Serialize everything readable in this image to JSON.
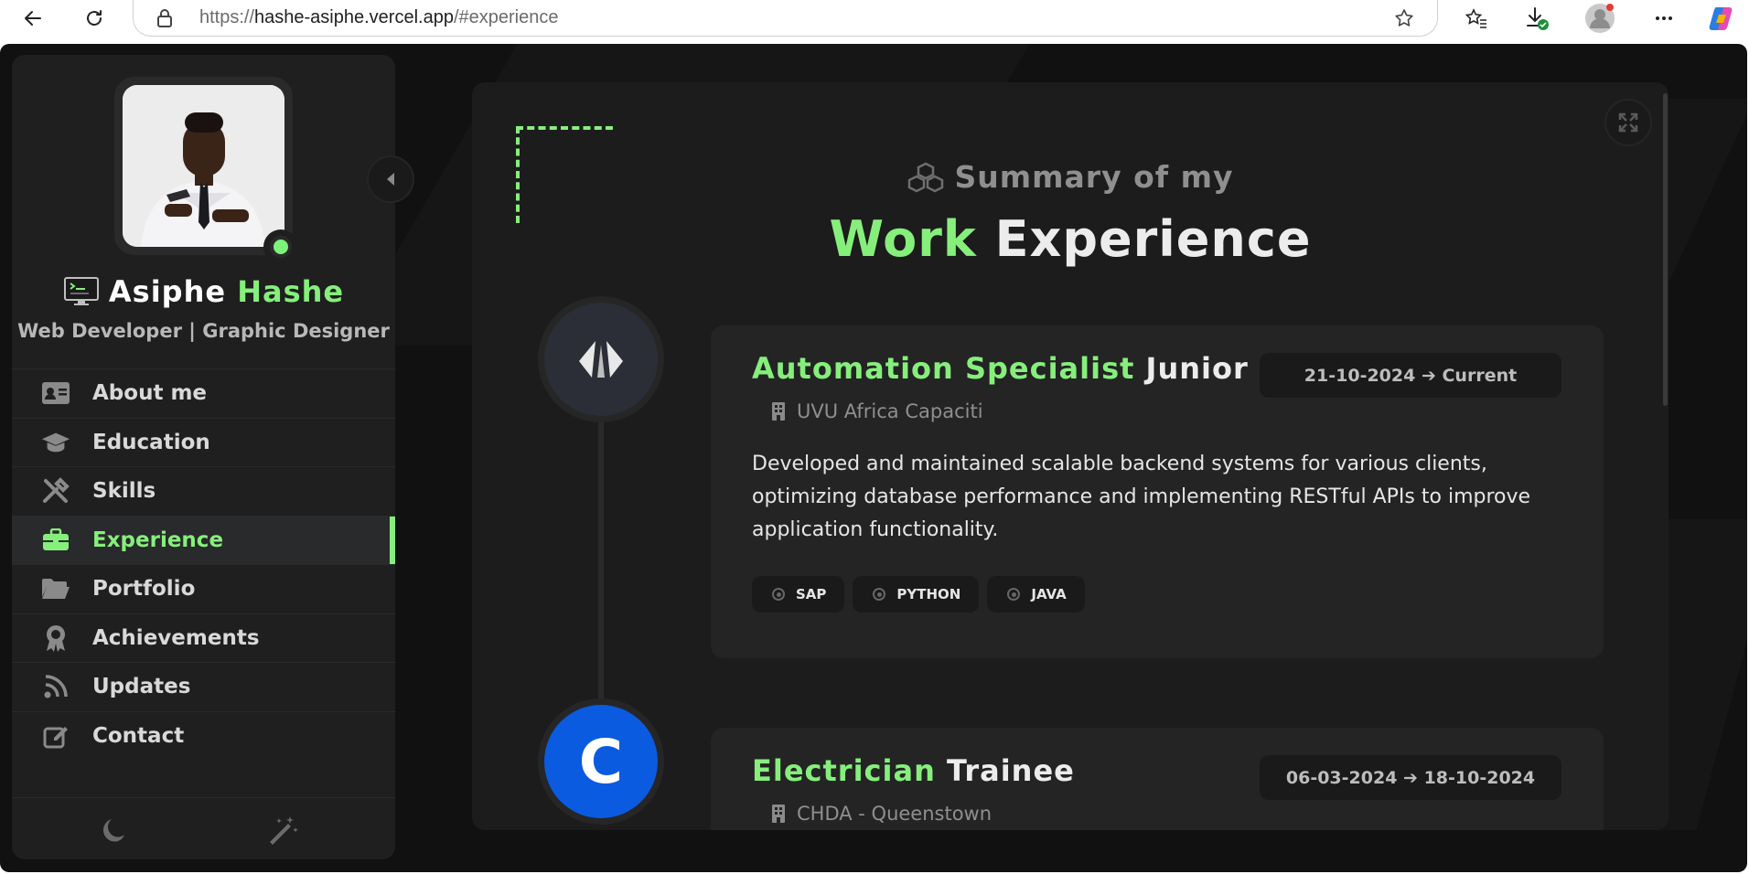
{
  "browser": {
    "url_prefix": "https://",
    "url_host": "hashe-asiphe.vercel.app",
    "url_path": "/#experience"
  },
  "profile": {
    "first_name": "Asiphe",
    "last_name": "Hashe",
    "role": "Web Developer | Graphic Designer",
    "status": "online"
  },
  "nav": {
    "items": [
      {
        "label": "About me",
        "icon": "id-card-icon"
      },
      {
        "label": "Education",
        "icon": "graduation-cap-icon"
      },
      {
        "label": "Skills",
        "icon": "tools-icon"
      },
      {
        "label": "Experience",
        "icon": "briefcase-icon",
        "active": true
      },
      {
        "label": "Portfolio",
        "icon": "folder-open-icon"
      },
      {
        "label": "Achievements",
        "icon": "award-icon"
      },
      {
        "label": "Updates",
        "icon": "rss-icon"
      },
      {
        "label": "Contact",
        "icon": "edit-icon"
      }
    ]
  },
  "section": {
    "subtitle": "Summary of my",
    "title_accent": "Work",
    "title_rest": "Experience"
  },
  "jobs": [
    {
      "title": "Automation Specialist",
      "level": "Junior",
      "dates": "21-10-2024 ➔ Current",
      "company": "UVU Africa Capaciti",
      "description": "Developed and maintained scalable backend systems for various clients, optimizing database performance and implementing RESTful APIs to improve application functionality.",
      "tags": [
        "SAP",
        "PYTHON",
        "JAVA"
      ]
    },
    {
      "title": "Electrician",
      "level": "Trainee",
      "dates": "06-03-2024 ➔ 18-10-2024",
      "company": "CHDA - Queenstown",
      "logo_letter": "C"
    }
  ],
  "colors": {
    "accent": "#86EF7C",
    "background": "#111111",
    "panel": "#1c1c1c",
    "card": "#242424",
    "company_logo_blue": "#0A5BE0"
  }
}
